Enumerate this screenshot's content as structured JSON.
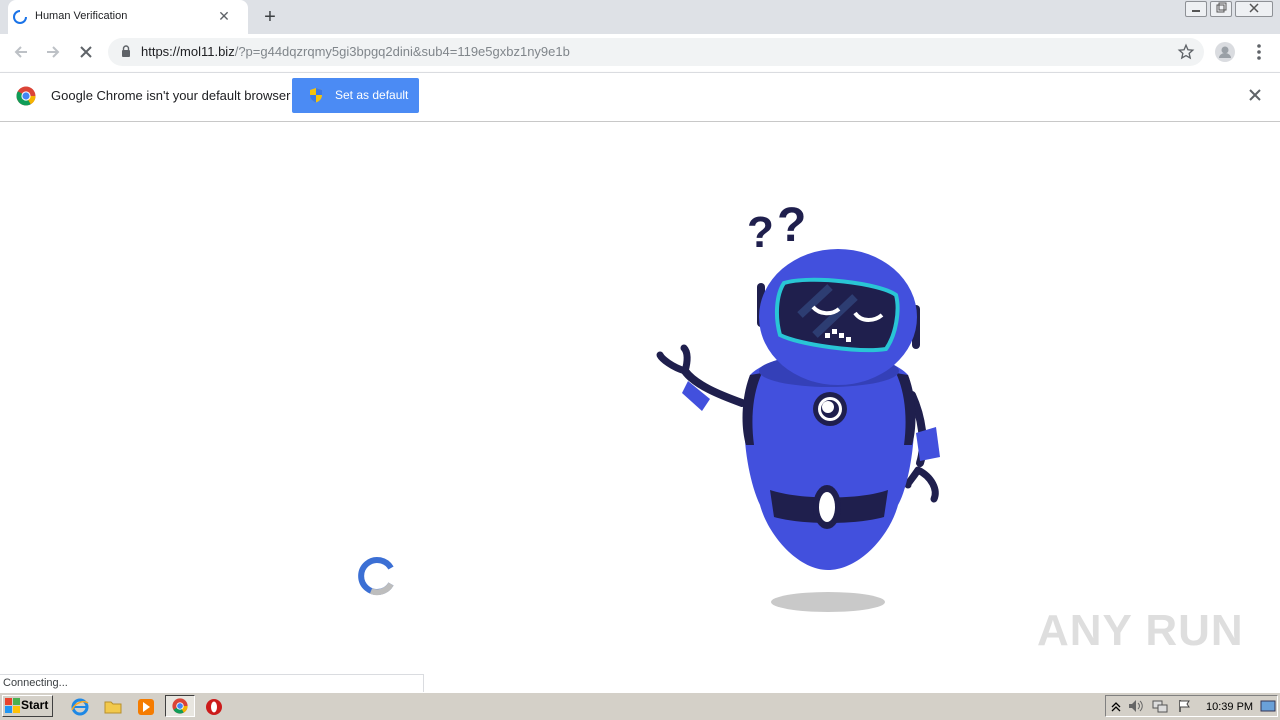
{
  "browser": {
    "tab": {
      "title": "Human Verification"
    },
    "url": {
      "host": "https://mol11.biz",
      "rest": "/?p=g44dqzrqmy5gi3bpgq2dini&sub4=119e5gxbz1ny9e1b"
    },
    "infobar": {
      "message": "Google Chrome isn't your default browser",
      "button_label": "Set as default"
    },
    "status": "Connecting..."
  },
  "watermark": "ANY RUN",
  "taskbar": {
    "start_label": "Start",
    "items": [
      "ie-icon",
      "folder-icon",
      "media-player-icon",
      "chrome-icon",
      "opera-icon"
    ],
    "clock": "10:39 PM"
  },
  "colors": {
    "accent_button": "#4b8bf4",
    "robot_body": "#4250dd",
    "robot_dark": "#1f1f4d",
    "visor": "#29c5d6"
  }
}
